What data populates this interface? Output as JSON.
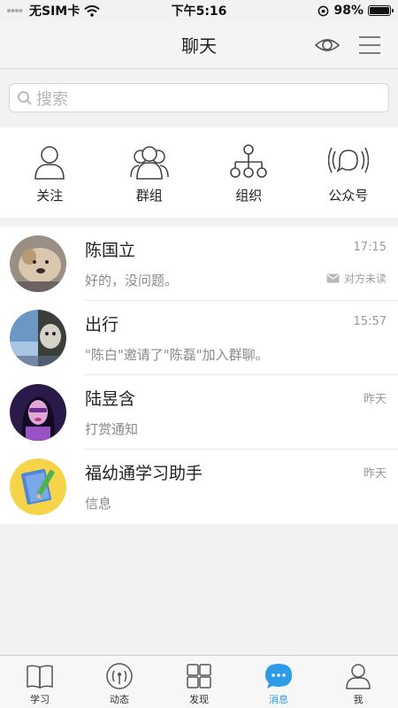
{
  "status_bar": {
    "carrier": "无SIM卡",
    "time": "下午5:16",
    "battery": "98%",
    "battery_level": 0.98
  },
  "nav": {
    "title": "聊天",
    "icons": [
      "eye-icon",
      "menu-icon"
    ]
  },
  "search": {
    "placeholder": "搜索"
  },
  "shortcuts": [
    {
      "label": "关注",
      "icon": "person-icon"
    },
    {
      "label": "群组",
      "icon": "group-icon"
    },
    {
      "label": "组织",
      "icon": "org-chart-icon"
    },
    {
      "label": "公众号",
      "icon": "broadcast-icon"
    }
  ],
  "chats": [
    {
      "name": "陈国立",
      "message": "好的，没问题。",
      "time": "17:15",
      "status": "对方未读",
      "status_icon": "envelope-icon"
    },
    {
      "name": "出行",
      "message": "\"陈白\"邀请了\"陈磊\"加入群聊。",
      "time": "15:57"
    },
    {
      "name": "陆昱含",
      "message": "打赏通知",
      "time": "昨天"
    },
    {
      "name": "福幼通学习助手",
      "message": "信息",
      "time": "昨天"
    }
  ],
  "tabs": [
    {
      "label": "学习",
      "icon": "book-icon"
    },
    {
      "label": "动态",
      "icon": "signal-icon"
    },
    {
      "label": "发现",
      "icon": "grid-icon"
    },
    {
      "label": "消息",
      "icon": "chat-bubble-icon",
      "active": true
    },
    {
      "label": "我",
      "icon": "person-icon"
    }
  ],
  "colors": {
    "accent": "#2d9be8",
    "background": "#f2f2f2",
    "secondary_text": "#8a8a8a"
  }
}
